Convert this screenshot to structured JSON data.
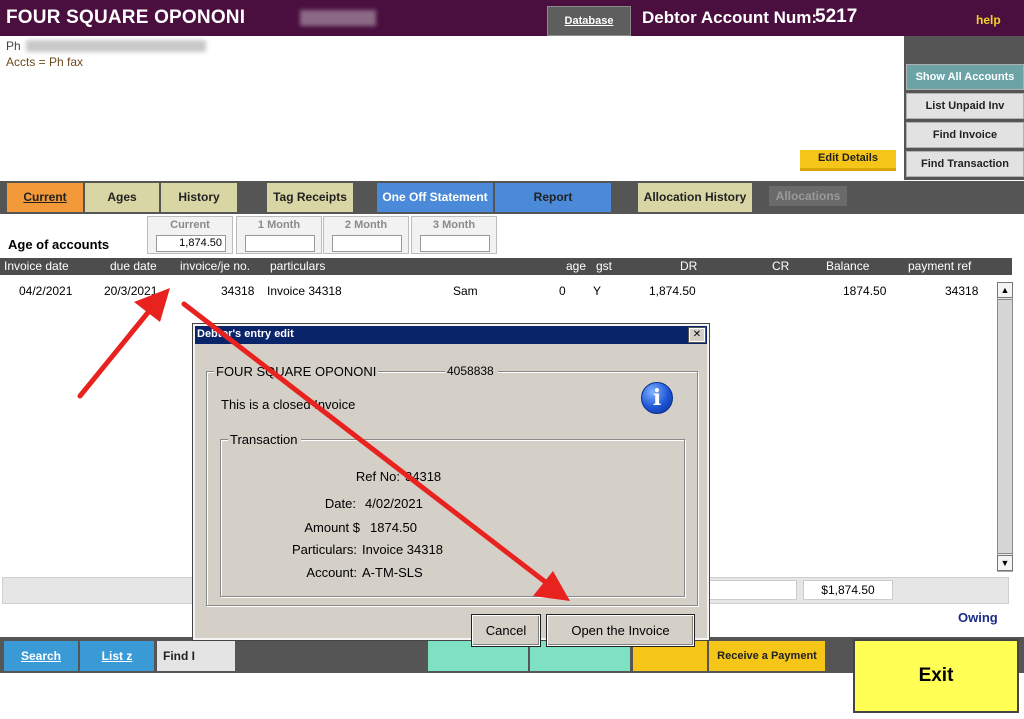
{
  "header": {
    "title": "FOUR SQUARE OPONONI",
    "database_label": "Database",
    "debtor_label": "Debtor Account Num:",
    "debtor_num": "5217",
    "help_label": "help"
  },
  "info": {
    "phone_prefix": "Ph",
    "accts_line": "Accts =  Ph  fax"
  },
  "side_buttons": {
    "show_all": "Show All Accounts",
    "list_unpaid": "List Unpaid Inv",
    "find_invoice": "Find Invoice",
    "find_transaction": "Find Transaction",
    "edit_details": "Edit Details"
  },
  "tabs": {
    "current": "Current",
    "ages": "Ages",
    "history": "History",
    "tag_receipts": "Tag Receipts",
    "one_off": "One Off Statement",
    "report": "Report",
    "allocation_history": "Allocation History",
    "allocations": "Allocations"
  },
  "ages": {
    "label": "Age of accounts",
    "current_label": "Current",
    "current_value": "1,874.50",
    "m1_label": "1 Month",
    "m1_value": "",
    "m2_label": "2 Month",
    "m2_value": "",
    "m3_label": "3 Month",
    "m3_value": ""
  },
  "grid": {
    "headers": {
      "invoice_date": "Invoice date",
      "due_date": "due date",
      "invoice_no": "invoice/je no.",
      "particulars": "particulars",
      "age": "age",
      "gst": "gst",
      "dr": "DR",
      "cr": "CR",
      "balance": "Balance",
      "payment_ref": "payment ref"
    },
    "rows": [
      {
        "invoice_date": "04/2/2021",
        "due_date": "20/3/2021",
        "invoice_no": "34318",
        "particulars": "Invoice 34318",
        "who": "Sam",
        "age": "0",
        "gst": "Y",
        "dr": "1,874.50",
        "cr": "",
        "balance": "1874.50",
        "payment_ref": "34318"
      }
    ]
  },
  "totals": {
    "amount": "$1,874.50",
    "owing_label": "Owing"
  },
  "bottom": {
    "search": "Search",
    "list_z": "List z",
    "find": "Find I",
    "receive_payment": "Receive a Payment",
    "exit": "Exit"
  },
  "dialog": {
    "title": "Debtor's entry edit",
    "close": "✕",
    "company": "FOUR SQUARE OPONONI",
    "code": "4058838",
    "status": "This is a closed Invoice",
    "transaction_label": "Transaction",
    "ref_label": "Ref No:",
    "ref_value": "34318",
    "date_label": "Date:",
    "date_value": "4/02/2021",
    "amount_label": "Amount $",
    "amount_value": "1874.50",
    "particulars_label": "Particulars:",
    "particulars_value": "Invoice 34318",
    "account_label": "Account:",
    "account_value": "A-TM-SLS",
    "cancel": "Cancel",
    "open_invoice": "Open the Invoice"
  },
  "colors": {
    "title_bar": "#4a0f3f",
    "accent_orange": "#f29a3a",
    "accent_blue": "#4a8ad8",
    "annotation_arrow": "#e8231f"
  }
}
